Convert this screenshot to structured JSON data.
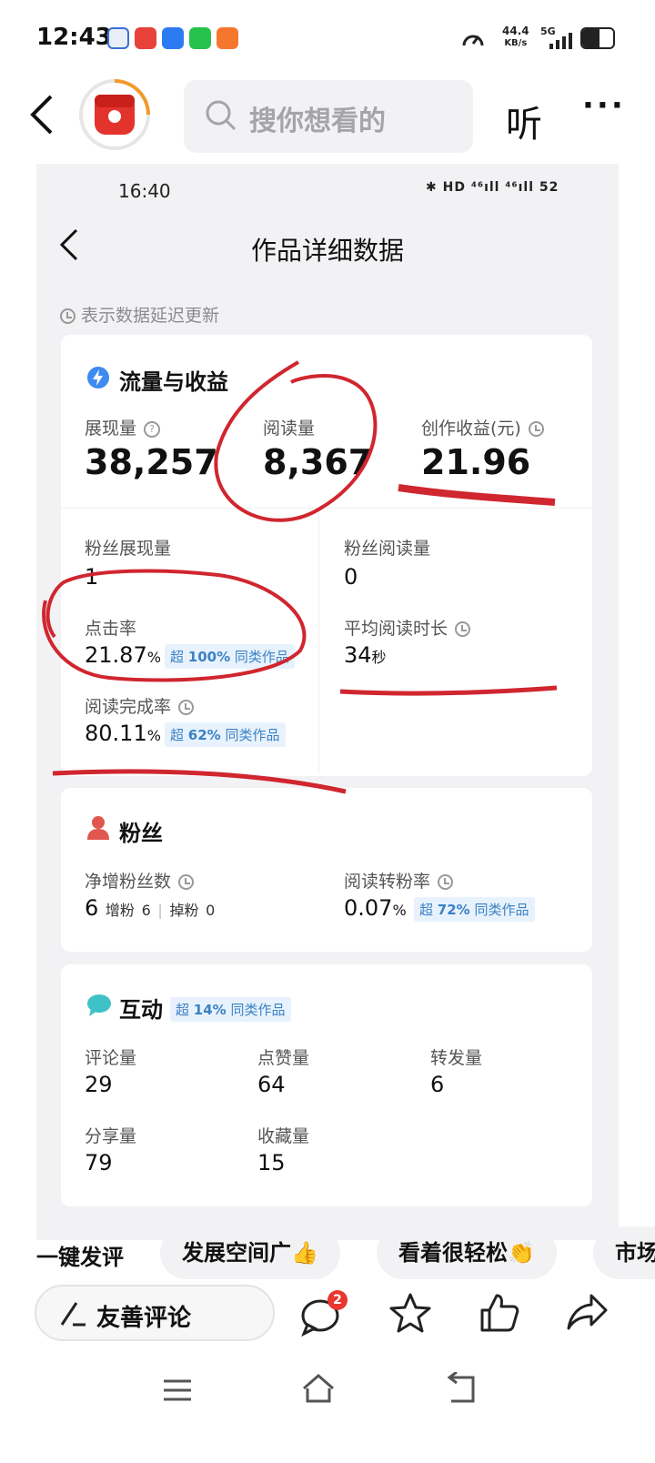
{
  "status_bar": {
    "time": "12:43",
    "net_speed": "44.4",
    "net_unit": "KB/s",
    "signal_label": "5G",
    "battery_percent": 55
  },
  "top_bar": {
    "search_placeholder": "搜你想看的",
    "listen_label": "听",
    "more_label": "···"
  },
  "inner_screen": {
    "status_time": "16:40",
    "status_icons": "✱ HD ⁴⁶ıll ⁴⁶ıll 52",
    "title": "作品详细数据",
    "delay_hint": "表示数据延迟更新"
  },
  "traffic_card": {
    "title": "流量与收益",
    "impressions_label": "展现量",
    "impressions_value": "38,257",
    "reads_label": "阅读量",
    "reads_value": "8,367",
    "earnings_label": "创作收益(元)",
    "earnings_value": "21.96",
    "fan_impressions_label": "粉丝展现量",
    "fan_impressions_value": "1",
    "fan_reads_label": "粉丝阅读量",
    "fan_reads_value": "0",
    "ctr_label": "点击率",
    "ctr_value": "21.87",
    "ctr_unit": "%",
    "ctr_badge_pre": "超",
    "ctr_badge_pct": "100%",
    "ctr_badge_post": "同类作品",
    "avg_time_label": "平均阅读时长",
    "avg_time_value": "34",
    "avg_time_unit": "秒",
    "completion_label": "阅读完成率",
    "completion_value": "80.11",
    "completion_unit": "%",
    "completion_badge_pre": "超",
    "completion_badge_pct": "62%",
    "completion_badge_post": "同类作品"
  },
  "fans_card": {
    "title": "粉丝",
    "net_fans_label": "净增粉丝数",
    "net_fans_value": "6",
    "gain_label": "增粉",
    "gain_value": "6",
    "lost_label": "掉粉",
    "lost_value": "0",
    "conversion_label": "阅读转粉率",
    "conversion_value": "0.07",
    "conversion_unit": "%",
    "conversion_badge_pre": "超",
    "conversion_badge_pct": "72%",
    "conversion_badge_post": "同类作品"
  },
  "interaction_card": {
    "title": "互动",
    "badge_pre": "超",
    "badge_pct": "14%",
    "badge_post": "同类作品",
    "comments_label": "评论量",
    "comments_value": "29",
    "likes_label": "点赞量",
    "likes_value": "64",
    "reposts_label": "转发量",
    "reposts_value": "6",
    "shares_label": "分享量",
    "shares_value": "79",
    "favorites_label": "收藏量",
    "favorites_value": "15"
  },
  "quick_comments": [
    "一键发评",
    "发展空间广👍",
    "看着很轻松👏",
    "市场"
  ],
  "bottom_bar": {
    "comment_placeholder": "友善评论",
    "comment_count": "2"
  },
  "colors": {
    "annotation_red": "#d0262f",
    "badge_blue": "#3b82c4",
    "accent_orange": "#f39a2b"
  }
}
